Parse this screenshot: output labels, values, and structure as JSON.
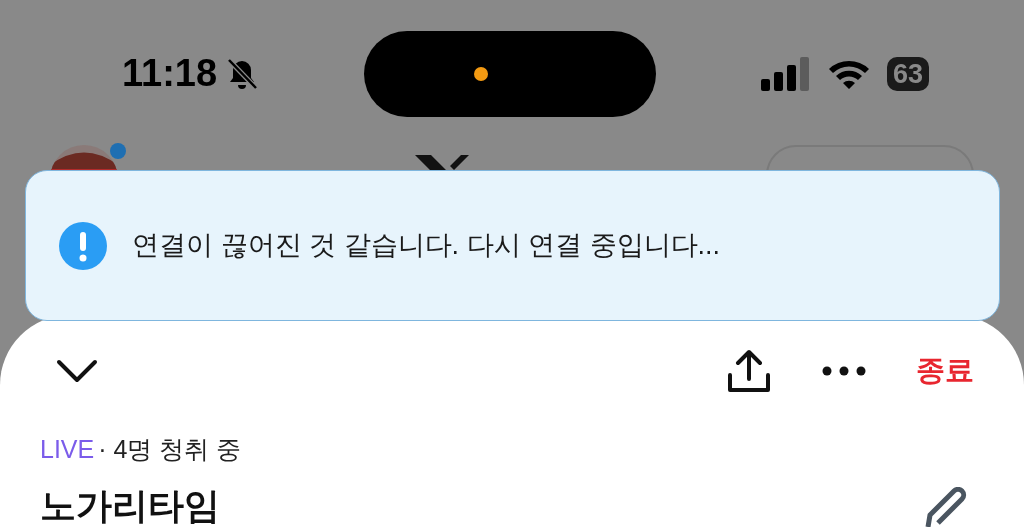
{
  "status_bar": {
    "time": "11:18",
    "muted": true,
    "battery": "63"
  },
  "header": {
    "avatar": {
      "kind": "picture",
      "unread": true
    }
  },
  "toast": {
    "message": "연결이 끊어진 것 같습니다. 다시 연결 중입니다..."
  },
  "sheet": {
    "end_button": "종료",
    "live": "LIVE",
    "listeners": "· 4명 청취 중",
    "title": "노가리타임"
  }
}
